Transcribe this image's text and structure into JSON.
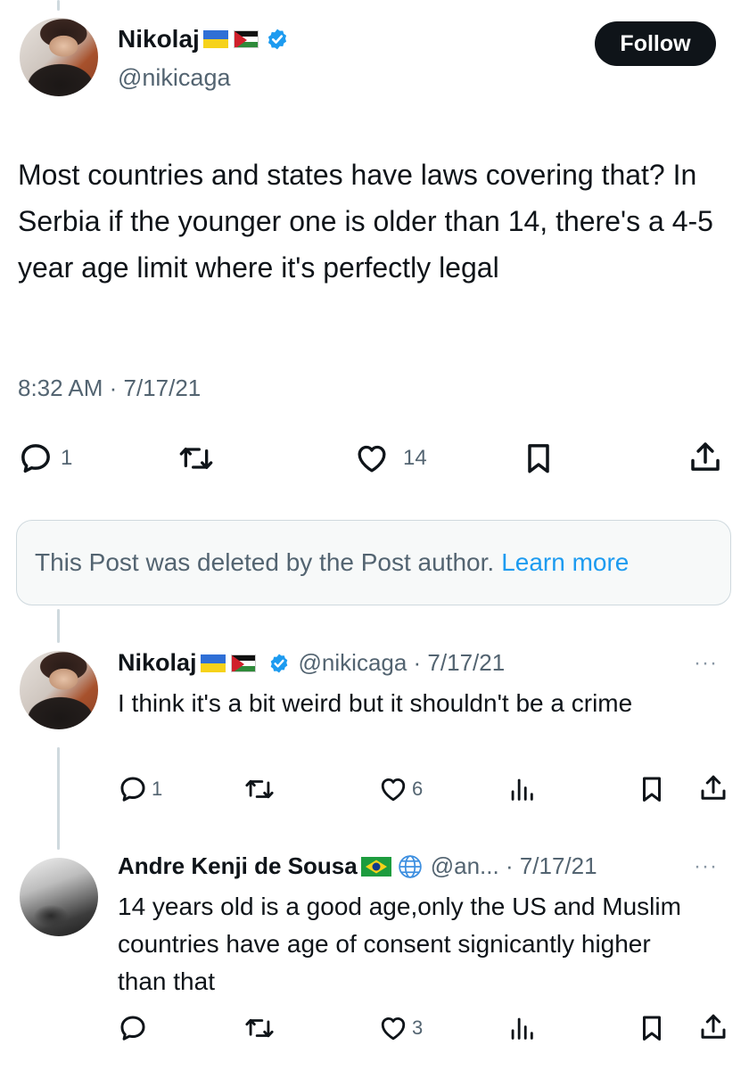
{
  "main_post": {
    "author_name": "Nikolaj",
    "handle": "@nikicaga",
    "follow_label": "Follow",
    "text": "Most countries and states have laws covering that? In Serbia if the younger one is older than 14, there's a 4-5 year age limit where it's perfectly legal",
    "timestamp": "8:32 AM · 7/17/21",
    "reply_count": "1",
    "like_count": "14"
  },
  "deleted_notice": {
    "text": "This Post was deleted by the Post author.",
    "link": "Learn more"
  },
  "replies": [
    {
      "author_name": "Nikolaj",
      "handle_date": "@nikicaga · 7/17/21",
      "text": "I think it's a bit weird but it shouldn't be  a crime",
      "reply_count": "1",
      "like_count": "6",
      "more": "···"
    },
    {
      "author_name": "Andre Kenji de Sousa",
      "handle_date": "@an... · 7/17/21",
      "text": "14 years old is a good age,only the US and Muslim countries have age of consent signicantly higher than that",
      "like_count": "3",
      "more": "···"
    }
  ],
  "colors": {
    "text": "#0f1419",
    "secondary": "#536471",
    "verified_blue": "#1d9bf0",
    "link_blue": "#1d9bf0",
    "follow_bg": "#0f1419"
  },
  "icons": [
    "verified-badge-icon",
    "reply-icon",
    "repost-icon",
    "like-icon",
    "bookmark-icon",
    "share-icon",
    "views-icon",
    "globe-icon",
    "more-icon"
  ]
}
